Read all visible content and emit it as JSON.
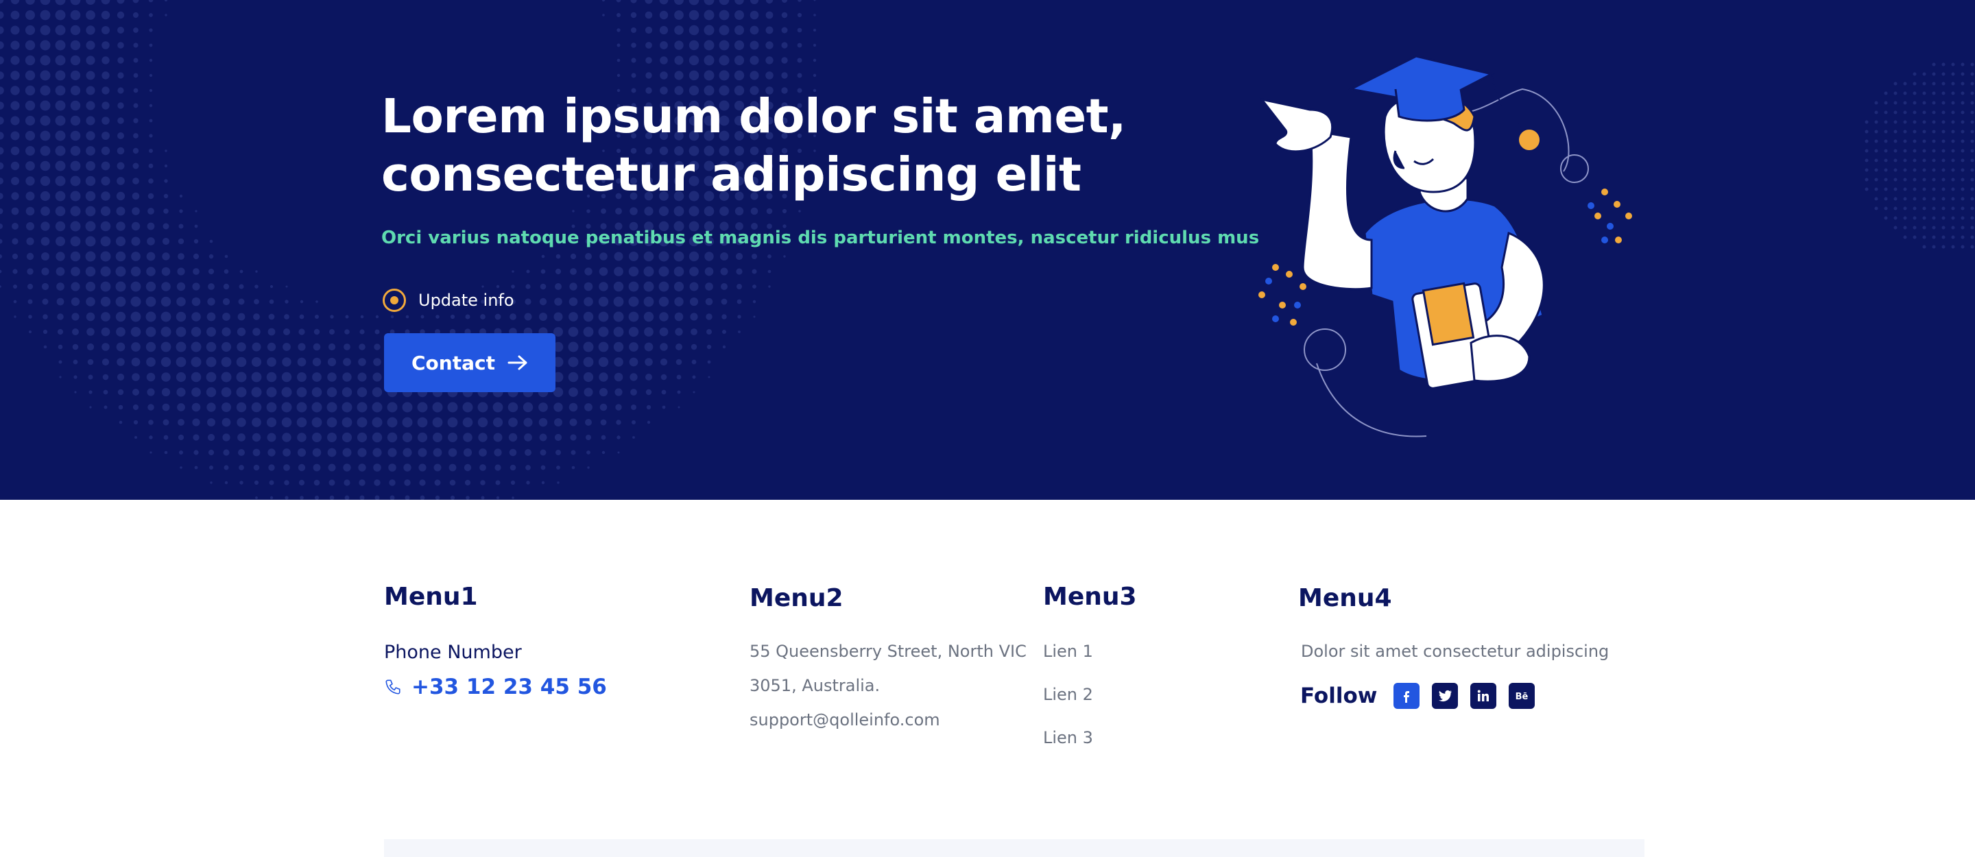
{
  "hero": {
    "title": "Lorem ipsum dolor sit amet,\nconsectetur adipiscing elit",
    "subtitle": "Orci varius natoque penatibus et magnis dis parturient montes, nascetur ridiculus mus",
    "radio_label": "Update info",
    "contact_label": "Contact",
    "illustration": "graduate-student-illustration"
  },
  "footer": {
    "menu1": {
      "title": "Menu1",
      "phone_label": "Phone Number",
      "phone": "+33 12 23 45 56",
      "icon": "phone-icon"
    },
    "menu2": {
      "title": "Menu2",
      "address_line1": "55 Queensberry Street, North VIC",
      "address_line2": "3051, Australia.",
      "email": "support@qolleinfo.com"
    },
    "menu3": {
      "title": "Menu3",
      "links": [
        "Lien 1",
        "Lien 2",
        "Lien 3"
      ]
    },
    "menu4": {
      "title": "Menu4",
      "text": "Dolor sit amet consectetur adipiscing",
      "follow_label": "Follow",
      "socials": [
        "facebook-icon",
        "twitter-icon",
        "linkedin-icon",
        "behance-icon"
      ]
    }
  },
  "colors": {
    "hero_bg": "#0b1560",
    "accent_blue": "#2256e0",
    "accent_green": "#5fdbb0",
    "accent_orange": "#f2a93b",
    "text_dark": "#0b1560",
    "text_muted": "#6b7280"
  }
}
